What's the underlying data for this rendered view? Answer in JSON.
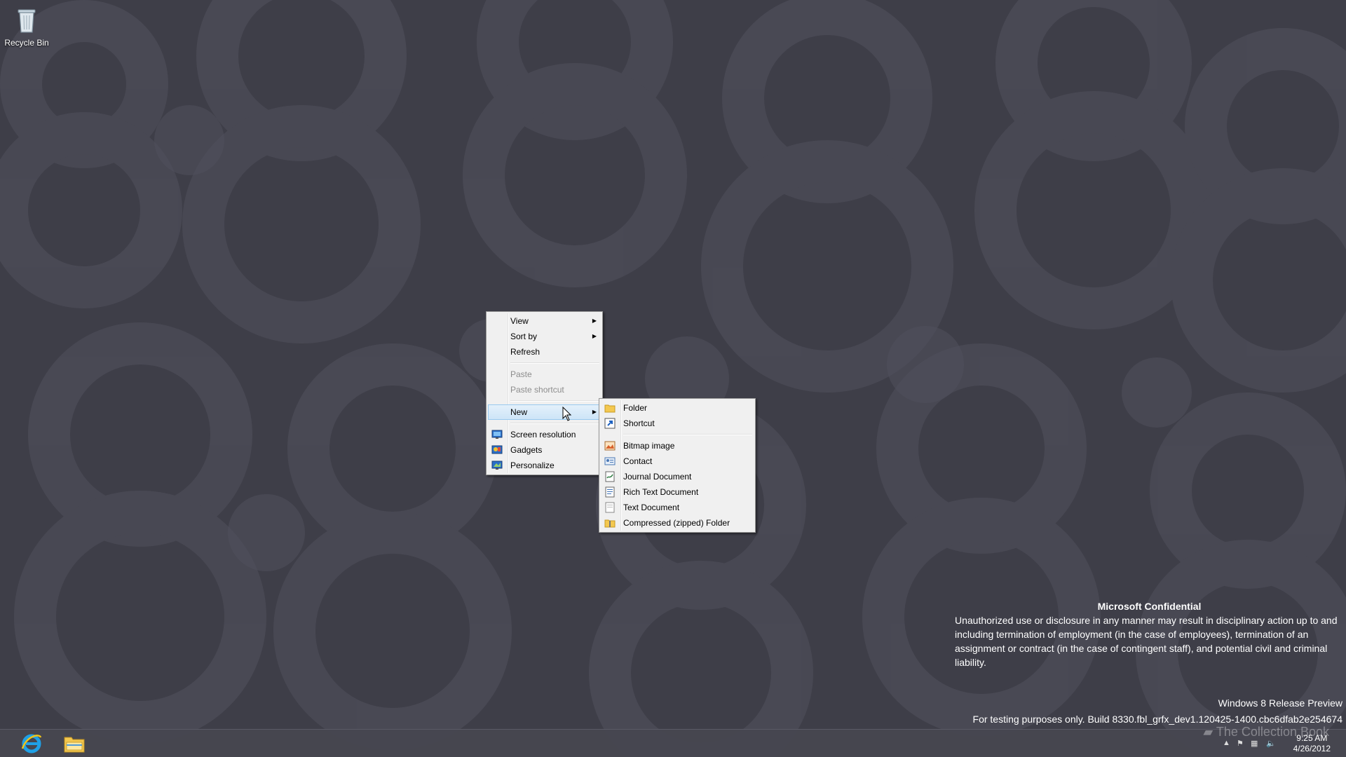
{
  "desktop": {
    "background_color": "#3e3e48",
    "icons": [
      {
        "label": "Recycle Bin",
        "icon": "recycle-bin-icon"
      }
    ]
  },
  "context_menu": {
    "items": [
      {
        "label": "View",
        "submenu": true
      },
      {
        "label": "Sort by",
        "submenu": true
      },
      {
        "label": "Refresh"
      },
      {
        "label": "Paste",
        "disabled": true
      },
      {
        "label": "Paste shortcut",
        "disabled": true
      },
      {
        "label": "New",
        "submenu": true,
        "highlighted": true
      },
      {
        "label": "Screen resolution",
        "icon": "screen-resolution-icon"
      },
      {
        "label": "Gadgets",
        "icon": "gadgets-icon"
      },
      {
        "label": "Personalize",
        "icon": "personalize-icon"
      }
    ]
  },
  "new_submenu": {
    "items": [
      {
        "label": "Folder",
        "icon": "folder-icon"
      },
      {
        "label": "Shortcut",
        "icon": "shortcut-icon"
      },
      {
        "label": "Bitmap image",
        "icon": "bitmap-image-icon"
      },
      {
        "label": "Contact",
        "icon": "contact-icon"
      },
      {
        "label": "Journal Document",
        "icon": "journal-document-icon"
      },
      {
        "label": "Rich Text Document",
        "icon": "rich-text-document-icon"
      },
      {
        "label": "Text Document",
        "icon": "text-document-icon"
      },
      {
        "label": "Compressed (zipped) Folder",
        "icon": "zipped-folder-icon"
      }
    ]
  },
  "confidential": {
    "title": "Microsoft Confidential",
    "body": "Unauthorized use or disclosure in any manner may result in disciplinary action up to and including termination of employment (in the case of employees), termination of an assignment or contract (in the case of contingent staff), and potential civil and criminal liability."
  },
  "watermark": {
    "edition": "Windows 8 Release Preview",
    "build": "For testing purposes only. Build 8330.fbl_grfx_dev1.120425-1400.cbc6dfab2e254674"
  },
  "overlay_logo_text": "The Collection Book",
  "taskbar": {
    "pinned": [
      {
        "name": "Internet Explorer",
        "icon": "internet-explorer-icon"
      },
      {
        "name": "File Explorer",
        "icon": "file-explorer-icon"
      }
    ],
    "tray": {
      "time": "9:25 AM",
      "date": "4/26/2012"
    }
  }
}
